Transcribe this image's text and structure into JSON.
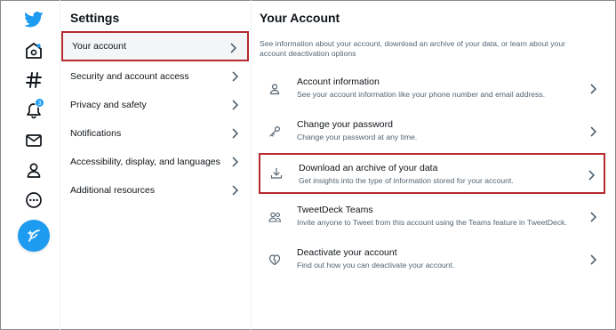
{
  "colors": {
    "brand": "#1d9bf0",
    "highlight_border": "#b52a2f"
  },
  "rail": {
    "icons": [
      "twitter-logo-icon",
      "home-icon",
      "explore-hashtag-icon",
      "notifications-bell-icon",
      "messages-envelope-icon",
      "profile-person-icon",
      "more-icon",
      "compose-tweet-icon"
    ],
    "notification_badge": "3"
  },
  "settings": {
    "title": "Settings",
    "items": [
      {
        "label": "Your account",
        "active": true
      },
      {
        "label": "Security and account access"
      },
      {
        "label": "Privacy and safety"
      },
      {
        "label": "Notifications"
      },
      {
        "label": "Accessibility, display, and languages"
      },
      {
        "label": "Additional resources"
      }
    ]
  },
  "account": {
    "title": "Your Account",
    "description": "See information about your account, download an archive of your data, or learn about your account deactivation options",
    "items": [
      {
        "icon": "person-icon",
        "label": "Account information",
        "sub": "See your account information like your phone number and email address."
      },
      {
        "icon": "key-icon",
        "label": "Change your password",
        "sub": "Change your password at any time."
      },
      {
        "icon": "download-icon",
        "label": "Download an archive of your data",
        "sub": "Get insights into the type of information stored for your account.",
        "highlighted": true
      },
      {
        "icon": "people-icon",
        "label": "TweetDeck Teams",
        "sub": "Invite anyone to Tweet from this account using the Teams feature in TweetDeck."
      },
      {
        "icon": "broken-heart-icon",
        "label": "Deactivate your account",
        "sub": "Find out how you can deactivate your account."
      }
    ]
  }
}
